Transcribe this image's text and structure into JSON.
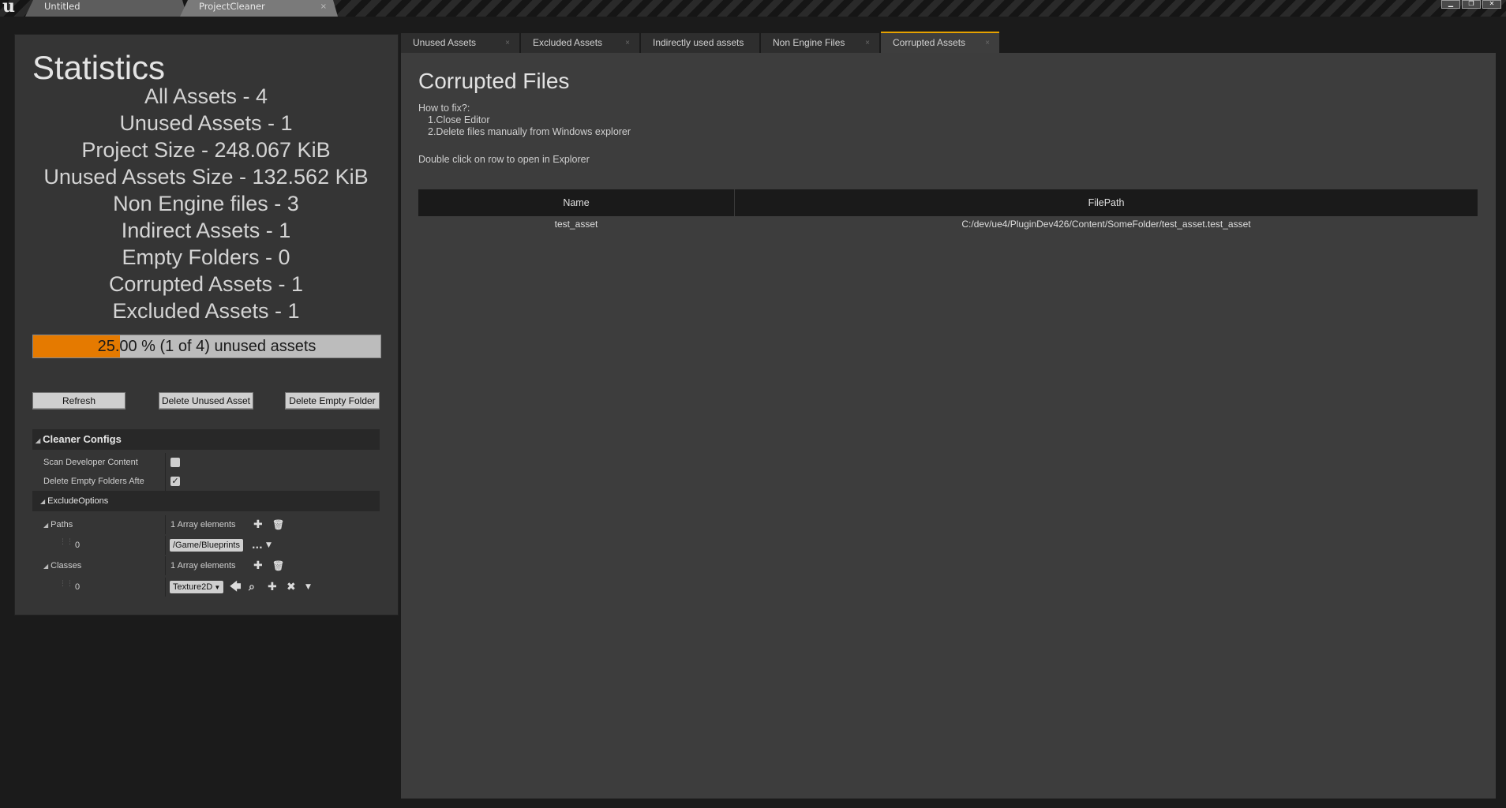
{
  "titlebar": {
    "tabs": [
      {
        "label": "Untitled"
      },
      {
        "label": "ProjectCleaner",
        "close": "×"
      }
    ],
    "window_controls": [
      "minimize-icon",
      "restore-icon",
      "close-icon"
    ]
  },
  "statistics": {
    "title": "Statistics",
    "lines": [
      "All Assets - 4",
      "Unused Assets - 1",
      "Project Size - 248.067 KiB",
      "Unused Assets Size - 132.562 KiB",
      "Non Engine files - 3",
      "Indirect Assets - 1",
      "Empty Folders - 0",
      "Corrupted Assets - 1",
      "Excluded Assets - 1"
    ],
    "progress": {
      "fraction": 0.25,
      "text": "25.00 % (1 of 4) unused assets",
      "fill_color": "#e57a00"
    }
  },
  "buttons": {
    "refresh": "Refresh",
    "delete_unused": "Delete Unused Asset",
    "delete_empty": "Delete Empty Folder"
  },
  "configs": {
    "header": "Cleaner Configs",
    "scan_dev_label": "Scan Developer Content",
    "scan_dev_checked": false,
    "delete_empty_label": "Delete Empty Folders Afte",
    "delete_empty_checked": true,
    "check_mark": "✓",
    "exclude_header": "ExcludeOptions",
    "paths_label": "Paths",
    "paths_count": "1 Array elements",
    "paths_index": "0",
    "paths_value": "/Game/Blueprints",
    "paths_more": "...",
    "classes_label": "Classes",
    "classes_count": "1 Array elements",
    "classes_index": "0",
    "classes_value": "Texture2D"
  },
  "tool_tabs": [
    {
      "label": "Unused Assets",
      "active": false
    },
    {
      "label": "Excluded Assets",
      "active": false
    },
    {
      "label": "Indirectly used assets",
      "active": false
    },
    {
      "label": "Non Engine Files",
      "active": false
    },
    {
      "label": "Corrupted Assets",
      "active": true
    }
  ],
  "content": {
    "title": "Corrupted Files",
    "help": [
      "How to fix?:",
      "1.Close Editor",
      "2.Delete files manually from Windows explorer"
    ],
    "hint": "Double click on row to open in Explorer",
    "table": {
      "columns": [
        "Name",
        "FilePath"
      ],
      "rows": [
        {
          "name": "test_asset",
          "path": "C:/dev/ue4/PluginDev426/Content/SomeFolder/test_asset.test_asset"
        }
      ]
    }
  }
}
